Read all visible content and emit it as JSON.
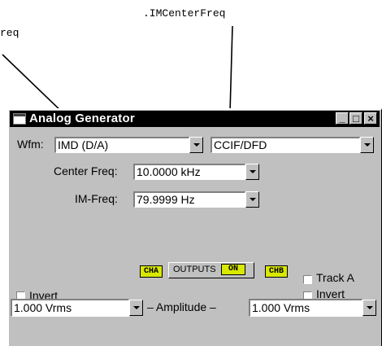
{
  "callouts": {
    "left": "req",
    "right": ".IMCenterFreq"
  },
  "window": {
    "title": "Analog Generator",
    "buttons": {
      "minimize": "_",
      "maximize": "□",
      "close": "×"
    }
  },
  "waveform": {
    "label": "Wfm:",
    "type_value": "IMD (D/A)",
    "mode_value": "CCIF/DFD"
  },
  "center_freq": {
    "label": "Center Freq:",
    "value": "10.0000 kHz"
  },
  "im_freq": {
    "label": "IM-Freq:",
    "value": "79.9999  Hz"
  },
  "channels": {
    "cha": "CHA",
    "chb": "CHB",
    "outputs_label": "OUTPUTS",
    "outputs_state": "ON"
  },
  "options": {
    "invert_left": "Invert",
    "track_a": "Track A",
    "invert_right": "Invert"
  },
  "amplitude": {
    "label": "– Amplitude –",
    "left_value": "1.000   Vrms",
    "right_value": "1.000   Vrms"
  },
  "colors": {
    "indicator": "#d8e800",
    "window_face": "#c0c0c0",
    "titlebar": "#000000"
  },
  "icons": [
    "system-menu-icon",
    "minimize-icon",
    "maximize-icon",
    "close-icon",
    "dropdown-arrow-icon"
  ]
}
